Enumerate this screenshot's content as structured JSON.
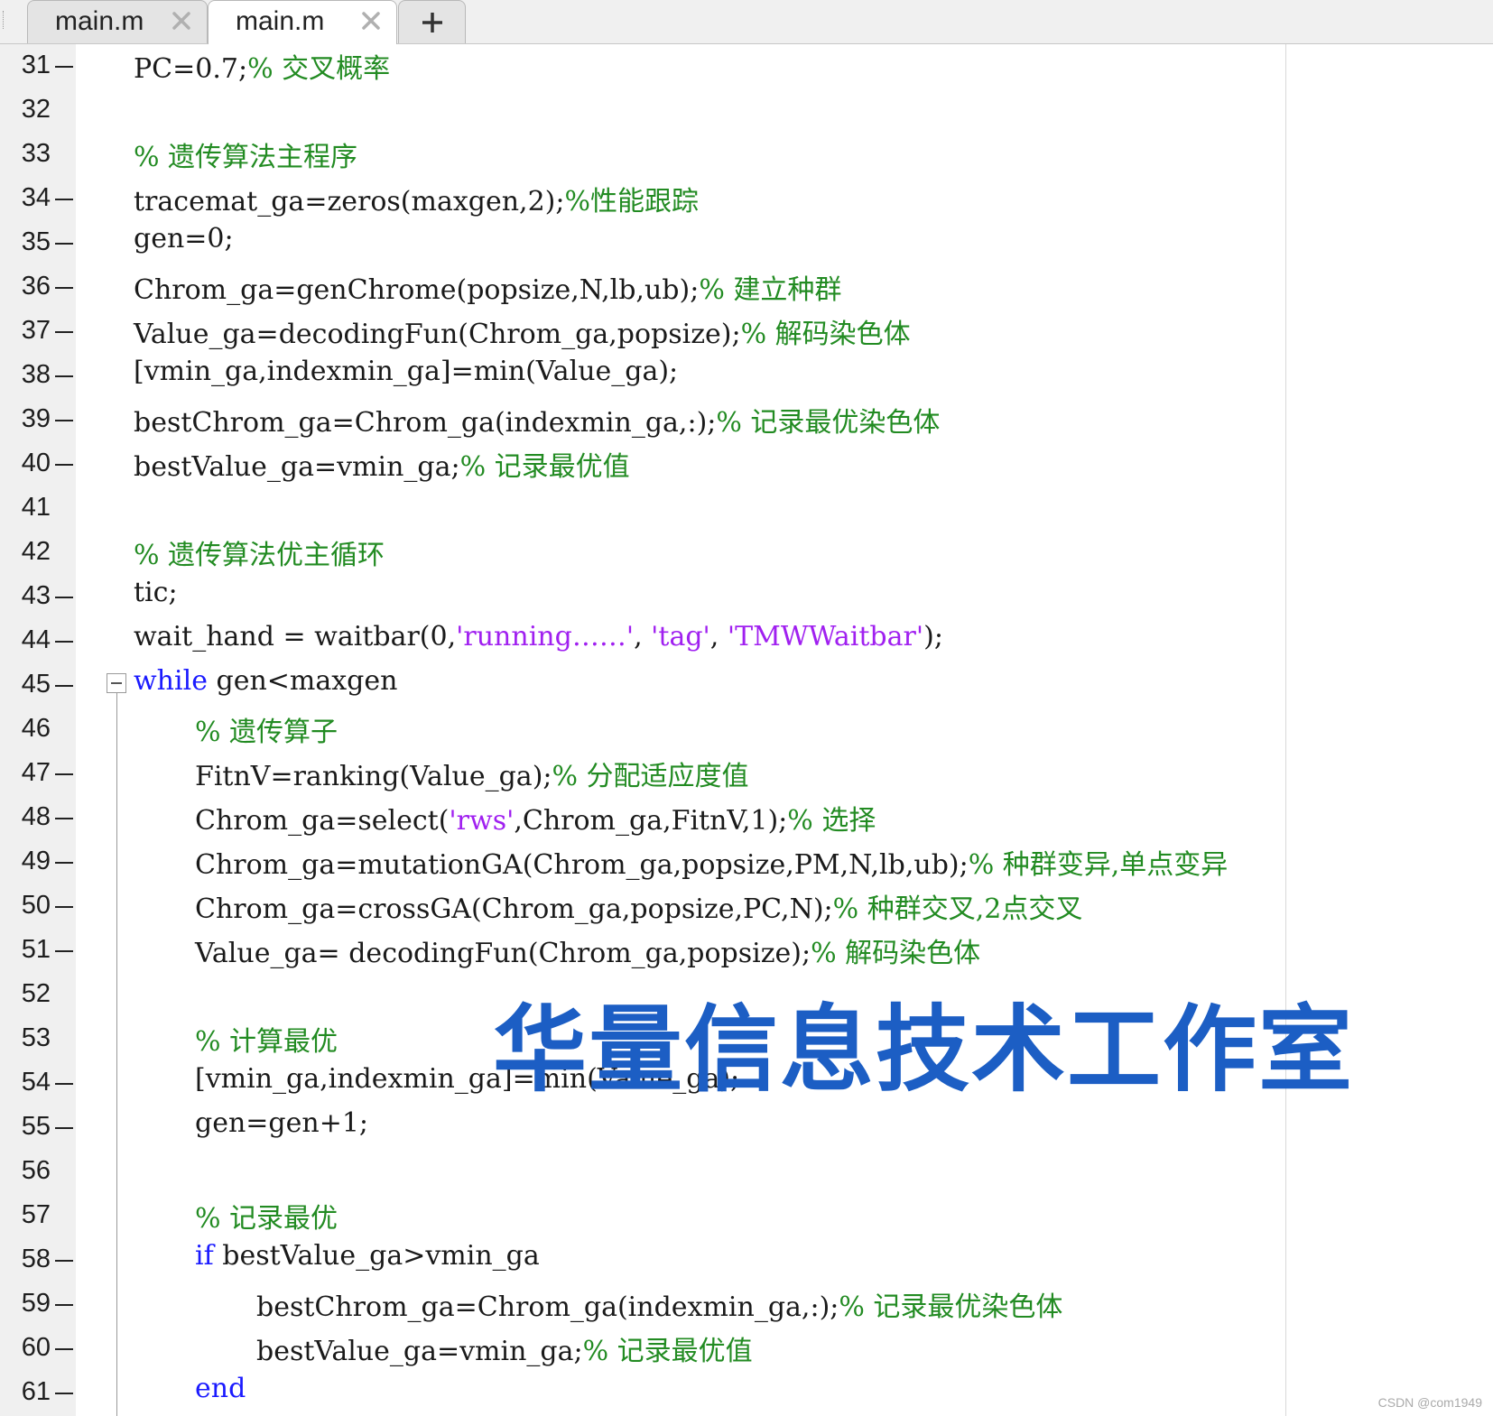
{
  "tabs": [
    {
      "label": "main.m",
      "active": false
    },
    {
      "label": "main.m",
      "active": true
    }
  ],
  "new_tab_icon": "plus-icon",
  "colors": {
    "keyword": "#1a1aff",
    "comment": "#228b22",
    "string": "#a020f0",
    "watermark": "#1c5ec4"
  },
  "lines": [
    {
      "num": "31",
      "dash": true,
      "indent": 1,
      "tokens": [
        {
          "t": "PC=0.7;",
          "c": "n"
        },
        {
          "t": "% 交叉概率",
          "c": "cm"
        }
      ]
    },
    {
      "num": "32",
      "dash": false,
      "indent": 1,
      "tokens": []
    },
    {
      "num": "33",
      "dash": false,
      "indent": 1,
      "tokens": [
        {
          "t": "% 遗传算法主程序",
          "c": "cm"
        }
      ]
    },
    {
      "num": "34",
      "dash": true,
      "indent": 1,
      "tokens": [
        {
          "t": "tracemat_ga=zeros(maxgen,2);",
          "c": "n"
        },
        {
          "t": "%性能跟踪",
          "c": "cm"
        }
      ]
    },
    {
      "num": "35",
      "dash": true,
      "indent": 1,
      "tokens": [
        {
          "t": "gen=0;",
          "c": "n"
        }
      ]
    },
    {
      "num": "36",
      "dash": true,
      "indent": 1,
      "tokens": [
        {
          "t": "Chrom_ga=genChrome(popsize,N,lb,ub);",
          "c": "n"
        },
        {
          "t": "% 建立种群",
          "c": "cm"
        }
      ]
    },
    {
      "num": "37",
      "dash": true,
      "indent": 1,
      "tokens": [
        {
          "t": "Value_ga=decodingFun(Chrom_ga,popsize);",
          "c": "n"
        },
        {
          "t": "% 解码染色体",
          "c": "cm"
        }
      ]
    },
    {
      "num": "38",
      "dash": true,
      "indent": 1,
      "tokens": [
        {
          "t": "[vmin_ga,indexmin_ga]=min(Value_ga);",
          "c": "n"
        }
      ]
    },
    {
      "num": "39",
      "dash": true,
      "indent": 1,
      "tokens": [
        {
          "t": "bestChrom_ga=Chrom_ga(indexmin_ga,:);",
          "c": "n"
        },
        {
          "t": "% 记录最优染色体",
          "c": "cm"
        }
      ]
    },
    {
      "num": "40",
      "dash": true,
      "indent": 1,
      "tokens": [
        {
          "t": "bestValue_ga=vmin_ga;",
          "c": "n"
        },
        {
          "t": "% 记录最优值",
          "c": "cm"
        }
      ]
    },
    {
      "num": "41",
      "dash": false,
      "indent": 1,
      "tokens": []
    },
    {
      "num": "42",
      "dash": false,
      "indent": 1,
      "tokens": [
        {
          "t": "% 遗传算法优主循环",
          "c": "cm"
        }
      ]
    },
    {
      "num": "43",
      "dash": true,
      "indent": 1,
      "tokens": [
        {
          "t": "tic;",
          "c": "n"
        }
      ]
    },
    {
      "num": "44",
      "dash": true,
      "indent": 1,
      "tokens": [
        {
          "t": "wait_hand = waitbar(0,",
          "c": "n"
        },
        {
          "t": "'running……'",
          "c": "st"
        },
        {
          "t": ", ",
          "c": "n"
        },
        {
          "t": "'tag'",
          "c": "st"
        },
        {
          "t": ", ",
          "c": "n"
        },
        {
          "t": "'TMWWaitbar'",
          "c": "st"
        },
        {
          "t": ");",
          "c": "n"
        }
      ]
    },
    {
      "num": "45",
      "dash": true,
      "indent": 1,
      "tokens": [
        {
          "t": "while",
          "c": "kw"
        },
        {
          "t": " gen<maxgen",
          "c": "n"
        }
      ]
    },
    {
      "num": "46",
      "dash": false,
      "indent": 2,
      "tokens": [
        {
          "t": "% 遗传算子",
          "c": "cm"
        }
      ]
    },
    {
      "num": "47",
      "dash": true,
      "indent": 2,
      "tokens": [
        {
          "t": "FitnV=ranking(Value_ga);",
          "c": "n"
        },
        {
          "t": "% 分配适应度值",
          "c": "cm"
        }
      ]
    },
    {
      "num": "48",
      "dash": true,
      "indent": 2,
      "tokens": [
        {
          "t": "Chrom_ga=select(",
          "c": "n"
        },
        {
          "t": "'rws'",
          "c": "st"
        },
        {
          "t": ",Chrom_ga,FitnV,1);",
          "c": "n"
        },
        {
          "t": "% 选择",
          "c": "cm"
        }
      ]
    },
    {
      "num": "49",
      "dash": true,
      "indent": 2,
      "tokens": [
        {
          "t": "Chrom_ga=mutationGA(Chrom_ga,popsize,PM,N,lb,ub);",
          "c": "n"
        },
        {
          "t": "% 种群变异,单点变异",
          "c": "cm"
        }
      ]
    },
    {
      "num": "50",
      "dash": true,
      "indent": 2,
      "tokens": [
        {
          "t": "Chrom_ga=crossGA(Chrom_ga,popsize,PC,N);",
          "c": "n"
        },
        {
          "t": "% 种群交叉,2点交叉",
          "c": "cm"
        }
      ]
    },
    {
      "num": "51",
      "dash": true,
      "indent": 2,
      "tokens": [
        {
          "t": "Value_ga= decodingFun(Chrom_ga,popsize);",
          "c": "n"
        },
        {
          "t": "% 解码染色体",
          "c": "cm"
        }
      ]
    },
    {
      "num": "52",
      "dash": false,
      "indent": 2,
      "tokens": []
    },
    {
      "num": "53",
      "dash": false,
      "indent": 2,
      "tokens": [
        {
          "t": "% 计算最优",
          "c": "cm"
        }
      ]
    },
    {
      "num": "54",
      "dash": true,
      "indent": 2,
      "tokens": [
        {
          "t": "[vmin_ga,indexmin_ga]=min(Value_ga);",
          "c": "n"
        }
      ]
    },
    {
      "num": "55",
      "dash": true,
      "indent": 2,
      "tokens": [
        {
          "t": "gen=gen+1;",
          "c": "n"
        }
      ]
    },
    {
      "num": "56",
      "dash": false,
      "indent": 2,
      "tokens": []
    },
    {
      "num": "57",
      "dash": false,
      "indent": 2,
      "tokens": [
        {
          "t": "% 记录最优",
          "c": "cm"
        }
      ]
    },
    {
      "num": "58",
      "dash": true,
      "indent": 2,
      "tokens": [
        {
          "t": "if",
          "c": "kw"
        },
        {
          "t": " bestValue_ga>vmin_ga",
          "c": "n"
        }
      ]
    },
    {
      "num": "59",
      "dash": true,
      "indent": 3,
      "tokens": [
        {
          "t": "bestChrom_ga=Chrom_ga(indexmin_ga,:);",
          "c": "n"
        },
        {
          "t": "% 记录最优染色体",
          "c": "cm"
        }
      ]
    },
    {
      "num": "60",
      "dash": true,
      "indent": 3,
      "tokens": [
        {
          "t": "bestValue_ga=vmin_ga;",
          "c": "n"
        },
        {
          "t": "% 记录最优值",
          "c": "cm"
        }
      ]
    },
    {
      "num": "61",
      "dash": true,
      "indent": 2,
      "tokens": [
        {
          "t": "end",
          "c": "kw"
        }
      ]
    }
  ],
  "watermark": "华量信息技术工作室",
  "credit": "CSDN @com1949"
}
